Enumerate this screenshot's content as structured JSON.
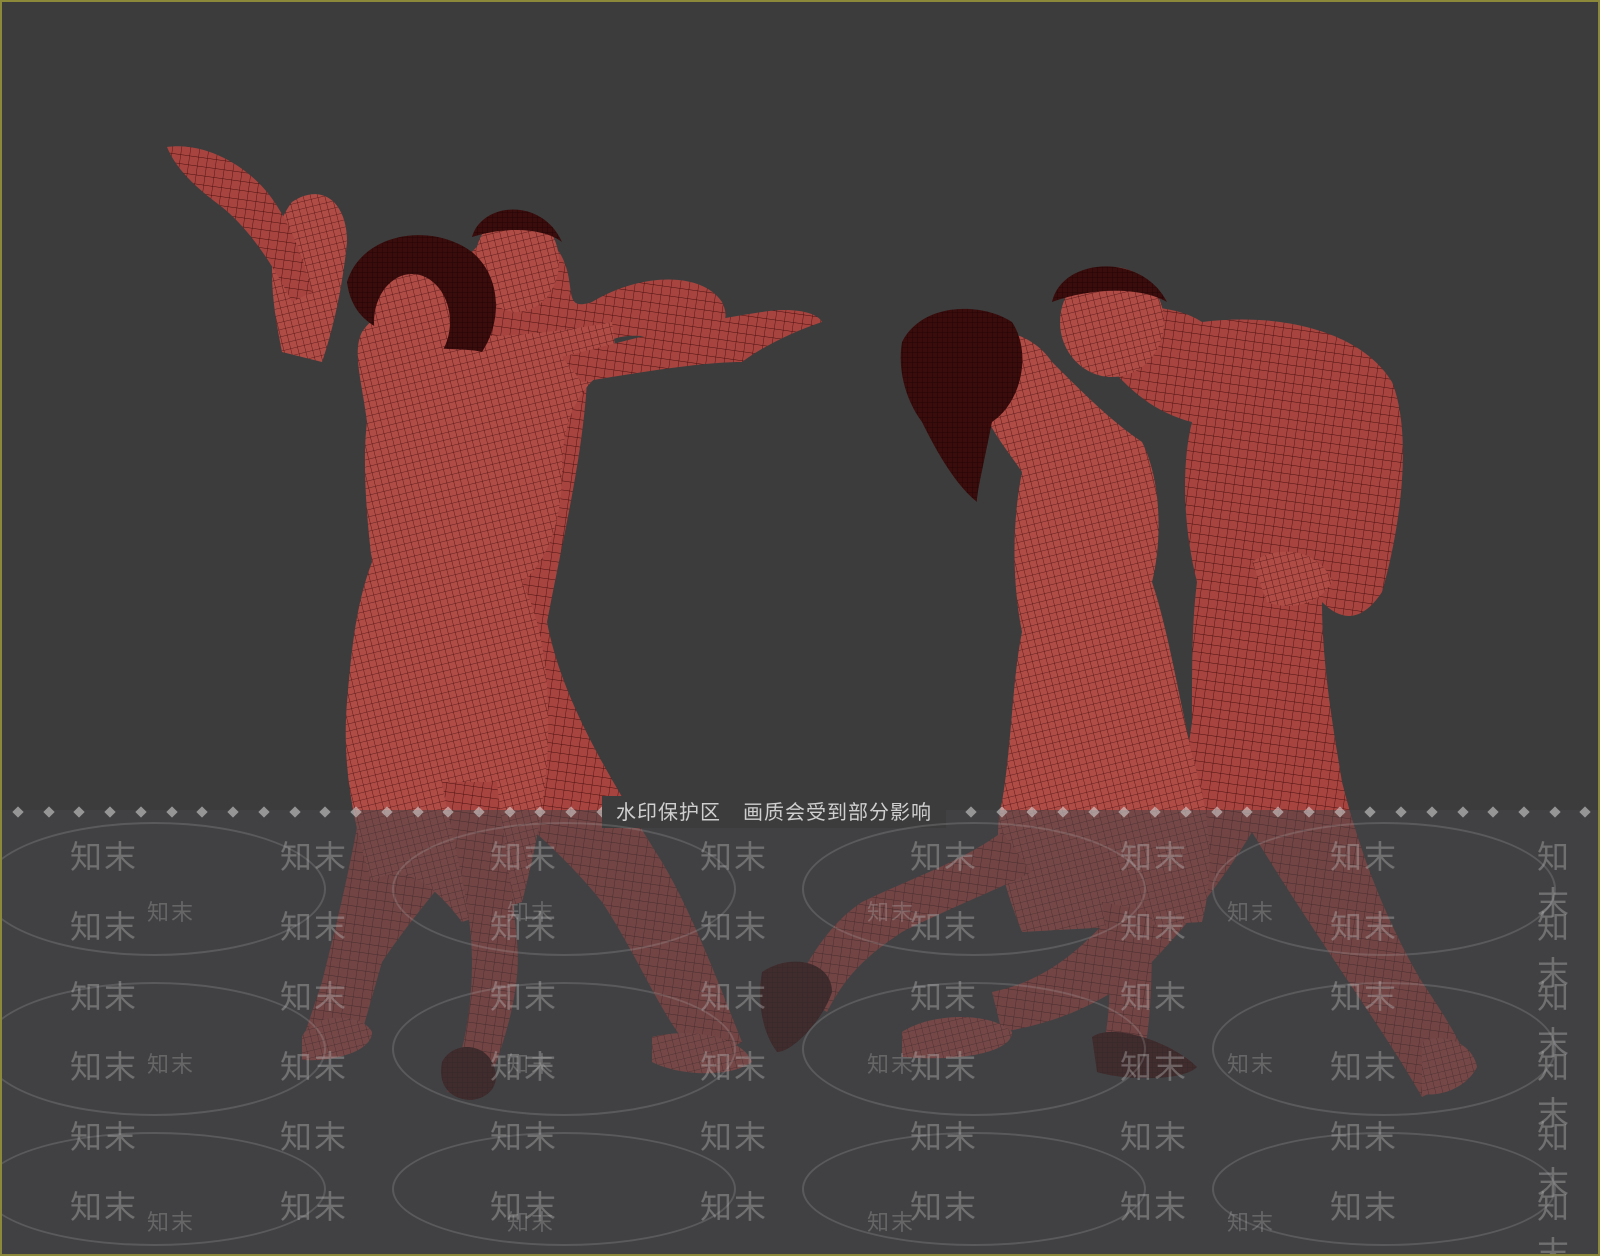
{
  "banner": {
    "part1": "水印保护区",
    "part2": "画质会受到部分影响"
  },
  "watermark": {
    "text": "知末"
  },
  "colors": {
    "viewport_bg": "#3c3c3c",
    "mesh": "#a8443f",
    "mesh_dark": "#5a1414",
    "border": "#8c8a3a"
  }
}
